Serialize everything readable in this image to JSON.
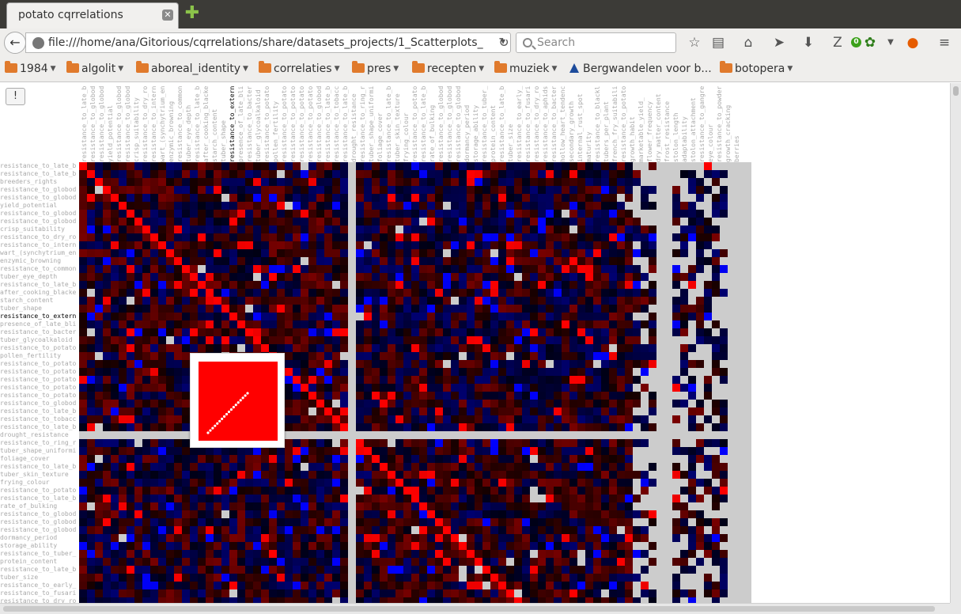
{
  "tab": {
    "title": "potato cqrrelations",
    "close": "✕",
    "new_tab": "✚"
  },
  "nav": {
    "url": "file:///home/ana/Gitorious/cqrrelations/share/datasets_projects/1_Scatterplots_",
    "search_placeholder": "Search",
    "badge_count": "0",
    "icons": [
      "back-icon",
      "reload-icon",
      "star-icon",
      "reading-list-icon",
      "home-icon",
      "send-icon",
      "download-icon",
      "zotero-icon",
      "addon-icon",
      "firefox-icon",
      "menu-icon"
    ]
  },
  "bookmarks": [
    {
      "label": "1984",
      "type": "folder"
    },
    {
      "label": "algolit",
      "type": "folder"
    },
    {
      "label": "aboreal_identity",
      "type": "folder"
    },
    {
      "label": "correlaties",
      "type": "folder"
    },
    {
      "label": "pres",
      "type": "folder"
    },
    {
      "label": "recepten",
      "type": "folder"
    },
    {
      "label": "muziek",
      "type": "folder"
    },
    {
      "label": "Bergwandelen voor b...",
      "type": "link"
    },
    {
      "label": "botopera",
      "type": "folder"
    }
  ],
  "content": {
    "button_label": "!",
    "active_trait": "resistance_to_extern",
    "col_labels": [
      "resistance_to_late_b",
      "resistance_to_globod",
      "resistance_to_globod",
      "yield_potential",
      "resistance_to_globod",
      "resistance_to_globod",
      "crisp_suitability",
      "resistance_to_dry_ro",
      "resistance_to_intern",
      "wart_(synchytrium_en",
      "enzymic_browning",
      "resistance_to_common",
      "tuber_eye_depth",
      "resistance_to_late_b",
      "after_cooking_blacke",
      "starch_content",
      "tuber_shape",
      "resistance_to_extern",
      "presence_of_late_bli",
      "resistance_to_bacter",
      "tuber_glycoalkaloid",
      "resistance_to_potato",
      "pollen_fertility",
      "resistance_to_potato",
      "resistance_to_potato",
      "resistance_to_potato",
      "resistance_to_potato",
      "resistance_to_globod",
      "resistance_to_late_b",
      "resistance_to_tobacc",
      "resistance_to_late_b",
      "drought_resistance",
      "resistance_to_ring_r",
      "tuber_shape_uniformi",
      "foliage_cover",
      "resistance_to_late_b",
      "tuber_skin_texture",
      "frying_colour",
      "resistance_to_potato",
      "resistance_to_late_b",
      "rate_of_bulking",
      "resistance_to_globod",
      "resistance_to_globod",
      "resistance_to_globod",
      "dormancy_period",
      "storage_ability",
      "resistance_to_tuber_",
      "protein_content",
      "resistance_to_late_b",
      "tuber_size",
      "resistance_to_early_",
      "resistance_to_fusari",
      "resistance_to_dry_ro",
      "resistance_to_aphids",
      "resistance_to_bacter",
      "hollow_heart_tendenc",
      "secondary_growth",
      "internal_rust_spot",
      "maturity",
      "resistance_to_blackl",
      "tubers_per_plant",
      "french_fry_suitabili",
      "resistance_to_potato",
      "growth_habit",
      "marketable_yield_",
      "flower_frequency",
      "dry_matter_content",
      "frost_resistance",
      "stolon_length",
      "adaptability",
      "stolon_attachment",
      "resistance_to_gangre",
      "eye_colour",
      "resistance_to_powder",
      "growth_cracking",
      "berries"
    ],
    "row_labels": [
      "resistance_to_late_b",
      "resistance_to_late_b",
      "breeders_rights",
      "resistance_to_globod",
      "resistance_to_globod",
      "yield_potential",
      "resistance_to_globod",
      "resistance_to_globod",
      "crisp_suitability",
      "resistance_to_dry_ro",
      "resistance_to_intern",
      "wart_(synchytrium_en",
      "enzymic_browning",
      "resistance_to_common",
      "tuber_eye_depth",
      "resistance_to_late_b",
      "after_cooking_blacke",
      "starch_content",
      "tuber_shape",
      "resistance_to_extern",
      "presence_of_late_bli",
      "resistance_to_bacter",
      "tuber_glycoalkaloid",
      "resistance_to_potato",
      "pollen_fertility",
      "resistance_to_potato",
      "resistance_to_potato",
      "resistance_to_potato",
      "resistance_to_potato",
      "resistance_to_potato",
      "resistance_to_globod",
      "resistance_to_late_b",
      "resistance_to_tobacc",
      "resistance_to_late_b",
      "drought_resistance",
      "resistance_to_ring_r",
      "tuber_shape_uniformi",
      "foliage_cover",
      "resistance_to_late_b",
      "tuber_skin_texture",
      "frying_colour",
      "resistance_to_potato",
      "resistance_to_late_b",
      "rate_of_bulking",
      "resistance_to_globod",
      "resistance_to_globod",
      "resistance_to_globod",
      "dormancy_period",
      "storage_ability",
      "resistance_to_tuber_",
      "protein_content",
      "resistance_to_late_b",
      "tuber_size",
      "resistance_to_early_",
      "resistance_to_fusari",
      "resistance_to_dry_ro"
    ]
  },
  "colors": {
    "positive": "#ff0000",
    "negative": "#0000ff",
    "missing": "#cccccc",
    "neutral": "#000000"
  }
}
